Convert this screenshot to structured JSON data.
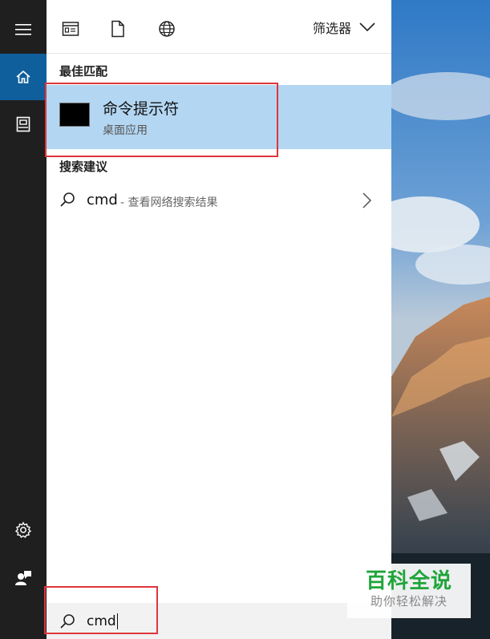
{
  "sidebar": {
    "items": [
      {
        "name": "hamburger-menu-icon"
      },
      {
        "name": "home-icon"
      },
      {
        "name": "document-icon"
      },
      {
        "name": "settings-gear-icon"
      },
      {
        "name": "user-feedback-icon"
      }
    ]
  },
  "topbar": {
    "tabs": [
      {
        "name": "apps-filter-icon"
      },
      {
        "name": "documents-filter-icon"
      },
      {
        "name": "web-filter-icon"
      }
    ],
    "filter_label": "筛选器"
  },
  "best_match": {
    "section_label": "最佳匹配",
    "title": "命令提示符",
    "subtitle": "桌面应用"
  },
  "suggestions": {
    "section_label": "搜索建议",
    "items": [
      {
        "query": "cmd",
        "desc": " - 查看网络搜索结果"
      }
    ]
  },
  "search": {
    "value": "cmd"
  },
  "watermark": {
    "title": "百科全说",
    "subtitle": "助你轻松解决"
  },
  "colors": {
    "sidebar_bg": "#1f1f1f",
    "active_accent": "#0f5f9c",
    "best_match_bg": "#b3d6f2",
    "highlight_box": "#e0363b",
    "watermark_green": "#1fa53a"
  }
}
